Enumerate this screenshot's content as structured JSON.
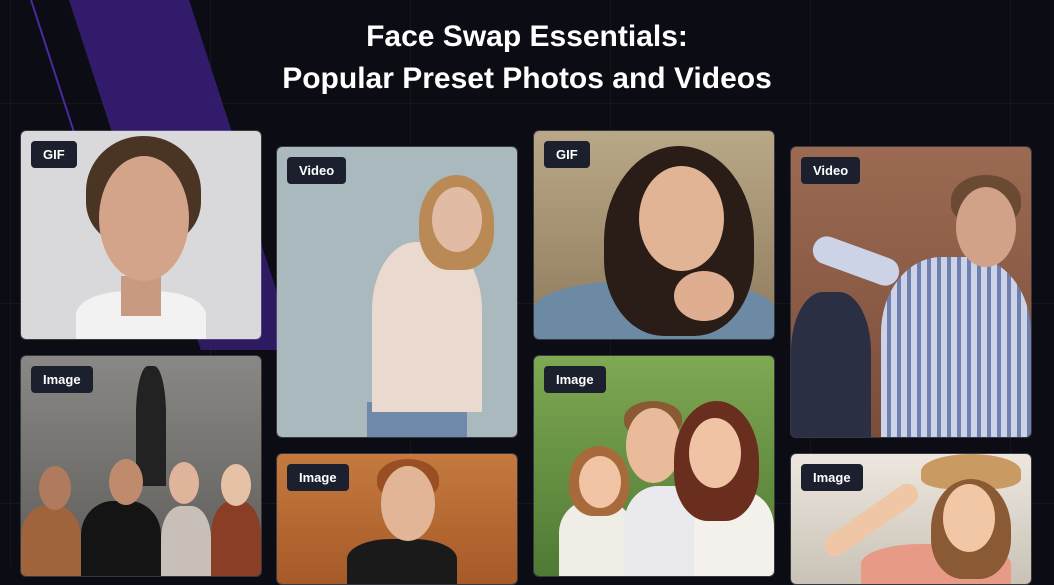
{
  "title": {
    "line1": "Face Swap Essentials:",
    "line2": "Popular Preset Photos and Videos"
  },
  "cards": [
    {
      "badge": "GIF"
    },
    {
      "badge": "Video"
    },
    {
      "badge": "GIF"
    },
    {
      "badge": "Video"
    },
    {
      "badge": "Image"
    },
    {
      "badge": "Image"
    },
    {
      "badge": "Image"
    },
    {
      "badge": "Image"
    }
  ],
  "colors": {
    "background": "#0c0c14",
    "accent_purple": "#3a1f7a",
    "badge_bg": "#1c1f2e"
  }
}
